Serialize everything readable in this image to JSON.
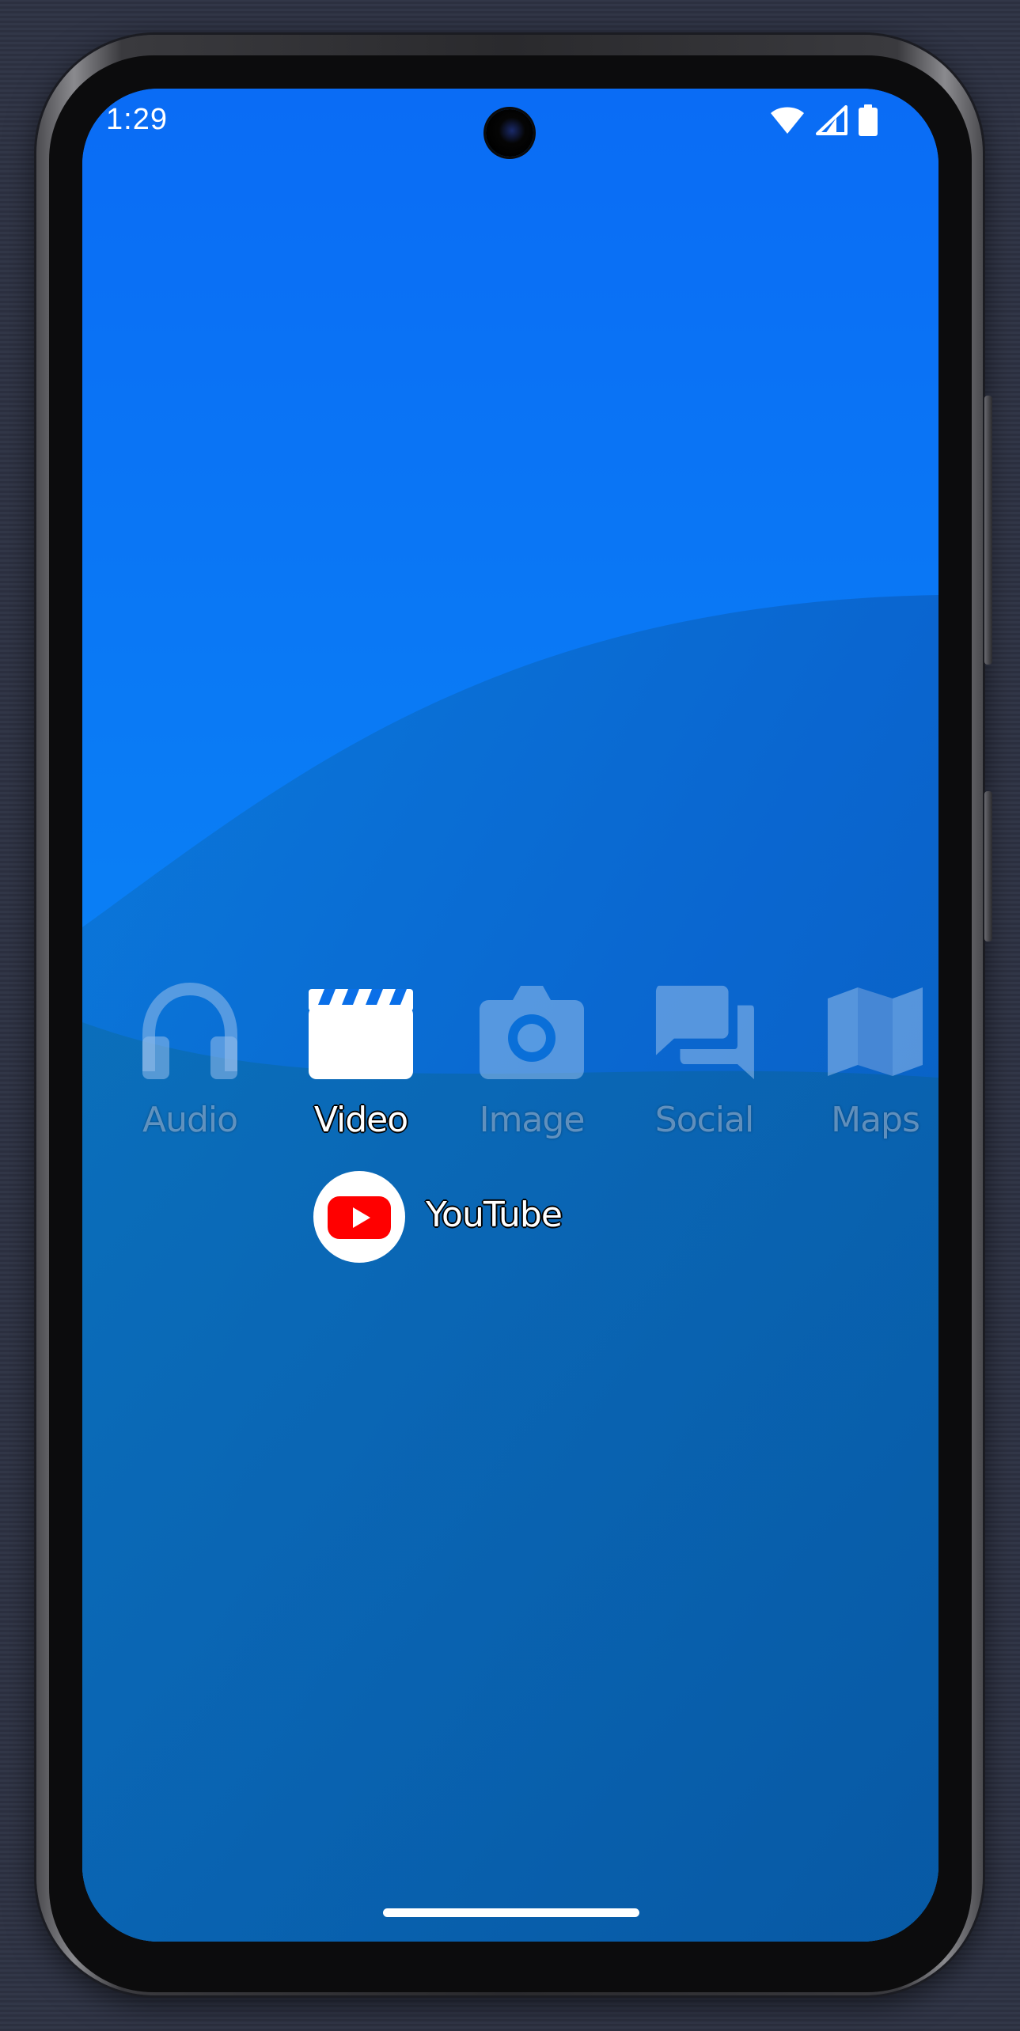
{
  "status_bar": {
    "time": "1:29",
    "icons": [
      "wifi-icon",
      "cell-signal-icon",
      "battery-icon"
    ]
  },
  "categories": [
    {
      "label": "Audio",
      "icon": "headphones-icon",
      "selected": false
    },
    {
      "label": "Video",
      "icon": "clapperboard-icon",
      "selected": true
    },
    {
      "label": "Image",
      "icon": "camera-icon",
      "selected": false
    },
    {
      "label": "Social",
      "icon": "chat-bubbles-icon",
      "selected": false
    },
    {
      "label": "Maps",
      "icon": "map-icon",
      "selected": false
    }
  ],
  "apps": [
    {
      "label": "YouTube",
      "icon": "youtube-icon",
      "brand_color": "#ff0000"
    }
  ],
  "colors": {
    "wallpaper_top": "#0a6ff2",
    "wallpaper_bottom": "#0863b8",
    "label_active": "#ffffff"
  }
}
